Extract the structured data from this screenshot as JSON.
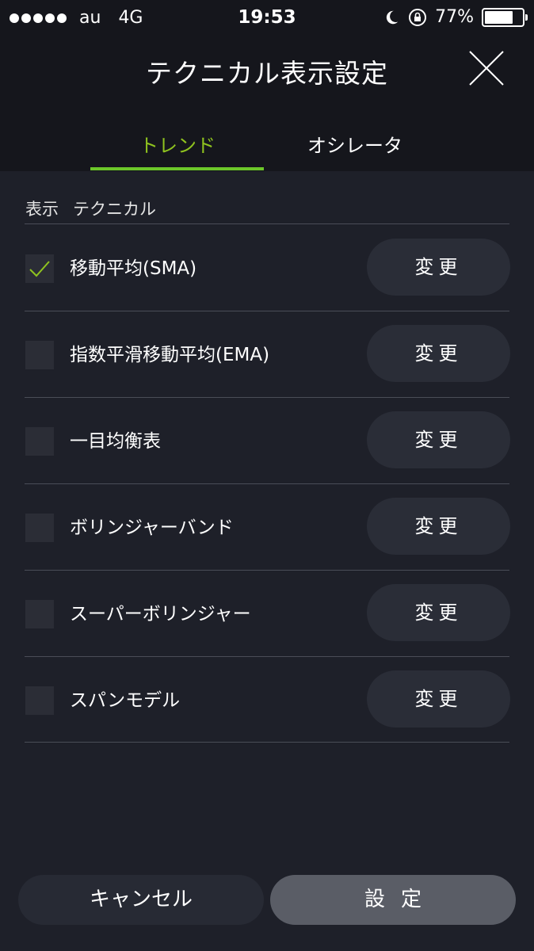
{
  "status_bar": {
    "carrier": "au",
    "network": "4G",
    "time": "19:53",
    "battery": "77%",
    "battery_level": 0.77,
    "icons": [
      "signal-dots",
      "moon-icon",
      "rotation-lock-icon",
      "battery-icon"
    ]
  },
  "header": {
    "title": "テクニカル表示設定",
    "close_icon": "close-icon"
  },
  "tabs": [
    {
      "label": "トレンド",
      "active": true
    },
    {
      "label": "オシレータ",
      "active": false
    }
  ],
  "list": {
    "columns": [
      "表示",
      "テクニカル"
    ],
    "items": [
      {
        "label": "移動平均(SMA)",
        "checked": true,
        "button": "変更"
      },
      {
        "label": "指数平滑移動平均(EMA)",
        "checked": false,
        "button": "変更"
      },
      {
        "label": "一目均衡表",
        "checked": false,
        "button": "変更"
      },
      {
        "label": "ボリンジャーバンド",
        "checked": false,
        "button": "変更"
      },
      {
        "label": "スーパーボリンジャー",
        "checked": false,
        "button": "変更"
      },
      {
        "label": "スパンモデル",
        "checked": false,
        "button": "変更"
      }
    ]
  },
  "footer": {
    "cancel_label": "キャンセル",
    "set_label": "設定"
  },
  "colors": {
    "accent": "#8fc31f",
    "background": "#1e2029",
    "header_background": "#15161c"
  }
}
